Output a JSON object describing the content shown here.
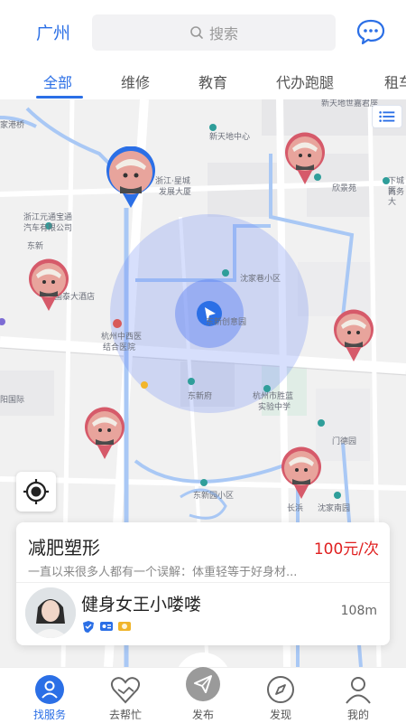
{
  "header": {
    "city": "广州",
    "search_placeholder": "搜索",
    "message_icon": "chat-bubble-icon"
  },
  "tabs": [
    {
      "label": "全部",
      "active": true
    },
    {
      "label": "维修",
      "active": false
    },
    {
      "label": "教育",
      "active": false
    },
    {
      "label": "代办跑腿",
      "active": false
    },
    {
      "label": "租车",
      "active": false
    }
  ],
  "map": {
    "labels": {
      "l1": "家港桥",
      "l2": "新天地世嘉君座",
      "l3": "新天地中心",
      "l4": "浙江·星城",
      "l5": "发展大厦",
      "l6": "下城区",
      "l7": "商务大",
      "l8": "欣景苑",
      "l9": "浙江元通宝通",
      "l10": "汽车有限公司",
      "l11": "东新",
      "l12": "沈家巷小区",
      "l13": "国泰大酒店",
      "l14": "杭州中西医",
      "l15": "结合医院",
      "l16": "东新创意园",
      "l17": "东新府",
      "l18": "杭州市胜蓝",
      "l19": "实验中学",
      "l20": "阳国际",
      "l21": "门德园",
      "l22": "东新园小区",
      "l23": "沈家南园",
      "l24": "长浜"
    }
  },
  "card": {
    "title": "减肥塑形",
    "price": "100元/次",
    "description": "一直以来很多人都有一个误解：体重轻等于好身材...",
    "name": "健身女王小喽喽",
    "distance": "108m"
  },
  "bottom_nav": [
    {
      "label": "找服务",
      "icon": "person-search-icon",
      "active": true
    },
    {
      "label": "去帮忙",
      "icon": "handshake-heart-icon",
      "active": false
    },
    {
      "label": "发布",
      "icon": "paper-plane-icon",
      "active": false
    },
    {
      "label": "发现",
      "icon": "compass-icon",
      "active": false
    },
    {
      "label": "我的",
      "icon": "user-icon",
      "active": false
    }
  ],
  "colors": {
    "accent": "#2b6fe6",
    "price": "#e02020",
    "map_bg": "#f1f1f1",
    "water": "#a9c8f5"
  }
}
